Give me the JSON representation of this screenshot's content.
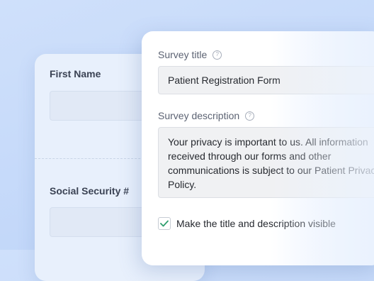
{
  "back_form": {
    "fields": [
      {
        "label": "First Name",
        "value": ""
      },
      {
        "label": "Social Security #",
        "value": ""
      }
    ]
  },
  "survey_settings": {
    "title_label": "Survey title",
    "title_value": "Patient Registration Form",
    "description_label": "Survey description",
    "description_value": "Your privacy is important to us. All information\nreceived through our forms and other\ncommunications is subject to our Patient Privacy\nPolicy.",
    "visibility_checkbox_label": "Make the title and description visible",
    "visibility_checked": true,
    "help_icon_glyph": "?"
  },
  "colors": {
    "check_accent": "#2f9e6e",
    "background": "#c5daf9"
  }
}
